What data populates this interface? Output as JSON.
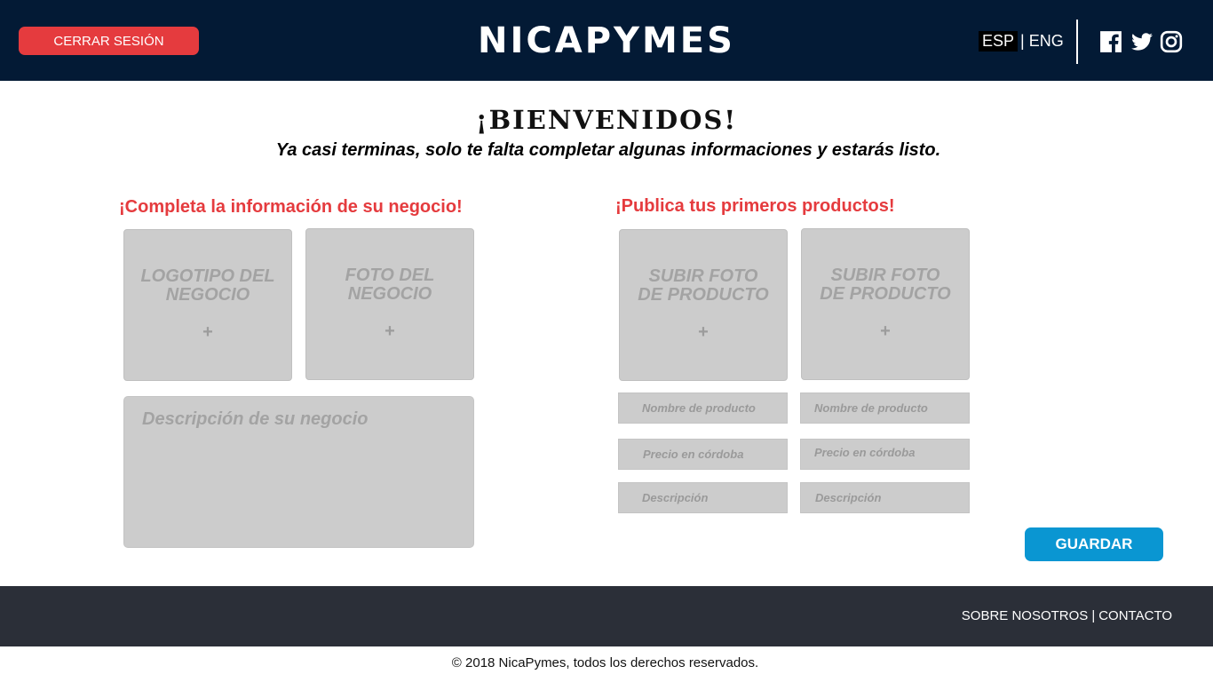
{
  "header": {
    "logout_label": "CERRAR SESIÓN",
    "brand": "NicaPymes",
    "lang_esp": "ESP",
    "lang_sep": "|",
    "lang_eng": "ENG",
    "social": [
      "facebook-icon",
      "twitter-icon",
      "instagram-icon"
    ]
  },
  "welcome": {
    "title": "¡BIENVENIDOS!",
    "subtitle": "Ya casi terminas, solo te falta completar algunas informaciones y estarás listo."
  },
  "business": {
    "heading": "¡Completa la información de su negocio!",
    "logo_line1": "LOGOTIPO DEL",
    "logo_line2": "NEGOCIO",
    "photo_line1": "FOTO DEL",
    "photo_line2": "NEGOCIO",
    "plus": "+",
    "description_placeholder": "Descripción de su negocio"
  },
  "products": {
    "heading": "¡Publica tus primeros productos!",
    "upload_line1": "SUBIR FOTO",
    "upload_line2": "DE PRODUCTO",
    "plus": "+",
    "name_placeholder": "Nombre de producto",
    "price_placeholder": "Precio en córdoba",
    "desc_placeholder": "Descripción"
  },
  "actions": {
    "save_label": "GUARDAR"
  },
  "footer": {
    "about": "SOBRE NOSOTROS",
    "sep": "|",
    "contact": "CONTACTO",
    "copyright": "© 2018 NicaPymes, todos los derechos reservados."
  },
  "colors": {
    "header_bg": "#031a35",
    "accent_red": "#e53b3e",
    "accent_blue": "#0a96d2",
    "footer_bg": "#2b2f38",
    "placeholder_box": "#cccccc"
  }
}
